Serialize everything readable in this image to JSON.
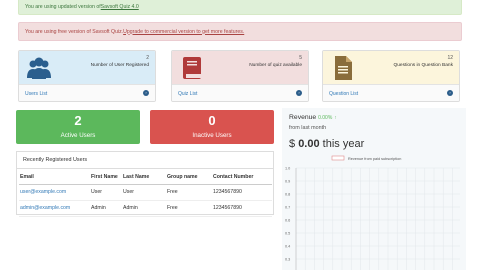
{
  "alerts": {
    "success_prefix": "You are using updated version of ",
    "success_link": "Savsoft Quiz 4.0",
    "danger_prefix": "You are using free version of Savsoft Quiz. ",
    "danger_link": "Upgrade to commercial version to get more features."
  },
  "cards": [
    {
      "count": "2",
      "label": "Number of User Registered",
      "link": "Users List",
      "icon": "users-icon",
      "color": "#2b5f8e",
      "bg": "#d9ecf7"
    },
    {
      "count": "5",
      "label": "Number of quiz available",
      "link": "Quiz List",
      "icon": "book-icon",
      "color": "#b03a3a",
      "bg": "#f2dede"
    },
    {
      "count": "12",
      "label": "Questions in Question Bank",
      "link": "Question List",
      "icon": "document-icon",
      "color": "#8a6d3b",
      "bg": "#fcf5dc"
    }
  ],
  "stats": {
    "active": {
      "value": "2",
      "label": "Active Users",
      "color": "#5cb85c"
    },
    "inactive": {
      "value": "0",
      "label": "Inactive Users",
      "color": "#d9534f"
    }
  },
  "recent": {
    "title": "Recently Registered Users",
    "headers": [
      "Email",
      "First Name",
      "Last Name",
      "Group name",
      "Contact Number"
    ],
    "rows": [
      [
        "user@example.com",
        "User",
        "User",
        "Free",
        "1234567890"
      ],
      [
        "admin@example.com",
        "Admin",
        "Admin",
        "Free",
        "1234567890"
      ]
    ]
  },
  "revenue": {
    "title": "Revenue",
    "change": "0.00%",
    "subtitle": "from last month",
    "currency": "$",
    "amount": "0.00",
    "period": "this year"
  },
  "chart_data": {
    "type": "line",
    "title": "",
    "legend": "Revenue from paid subscription",
    "legend_position": "top",
    "y_ticks": [
      "1.0",
      "0.9",
      "0.8",
      "0.7",
      "0.6",
      "0.5",
      "0.4",
      "0.3"
    ],
    "ylim": [
      0,
      1.0
    ],
    "grid": true,
    "series": [
      {
        "name": "Revenue from paid subscription",
        "values": []
      }
    ]
  }
}
